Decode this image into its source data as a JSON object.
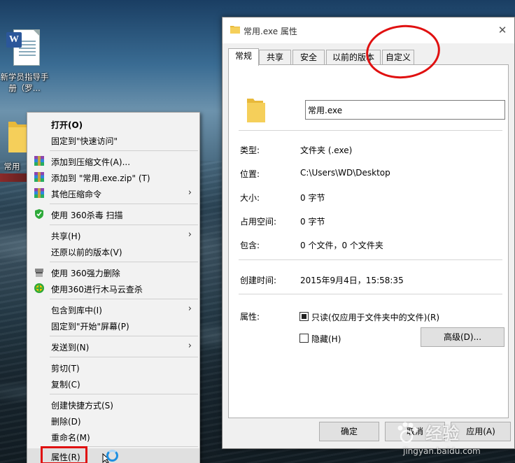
{
  "desktop": {
    "doc_icon_label": "新学员指导手册（罗...",
    "folder_icon_label": "常用"
  },
  "context_menu": {
    "items": [
      {
        "label": "打开(O)"
      },
      {
        "label": "固定到\"快速访问\""
      },
      {
        "label": "添加到压缩文件(A)..."
      },
      {
        "label": "添加到 \"常用.exe.zip\" (T)"
      },
      {
        "label": "其他压缩命令"
      },
      {
        "label": "使用 360杀毒 扫描"
      },
      {
        "label": "共享(H)"
      },
      {
        "label": "还原以前的版本(V)"
      },
      {
        "label": "使用 360强力删除"
      },
      {
        "label": "使用360进行木马云查杀"
      },
      {
        "label": "包含到库中(I)"
      },
      {
        "label": "固定到\"开始\"屏幕(P)"
      },
      {
        "label": "发送到(N)"
      },
      {
        "label": "剪切(T)"
      },
      {
        "label": "复制(C)"
      },
      {
        "label": "创建快捷方式(S)"
      },
      {
        "label": "删除(D)"
      },
      {
        "label": "重命名(M)"
      },
      {
        "label": "属性(R)"
      }
    ]
  },
  "dialog": {
    "title": "常用.exe 属性",
    "close_glyph": "✕",
    "tabs": [
      "常规",
      "共享",
      "安全",
      "以前的版本",
      "自定义"
    ],
    "active_tab": "常规",
    "name_value": "常用.exe",
    "props": {
      "type_label": "类型:",
      "type_value": "文件夹 (.exe)",
      "location_label": "位置:",
      "location_value": "C:\\Users\\WD\\Desktop",
      "size_label": "大小:",
      "size_value": "0 字节",
      "disk_label": "占用空间:",
      "disk_value": "0 字节",
      "contains_label": "包含:",
      "contains_value": "0 个文件，0 个文件夹",
      "created_label": "创建时间:",
      "created_value": "2015年9月4日，15:58:35",
      "attr_label": "属性:",
      "readonly_label": "只读(仅应用于文件夹中的文件)(R)",
      "readonly_checked": true,
      "hidden_label": "隐藏(H)",
      "hidden_checked": false,
      "advanced_button": "高级(D)..."
    },
    "buttons": {
      "ok": "确定",
      "cancel": "取消",
      "apply": "应用(A)"
    }
  },
  "watermark": {
    "logo_text": "Bai",
    "text": "经验",
    "url": "jingyan.baidu.com"
  },
  "colors": {
    "annotation_red": "#e01010",
    "folder_yellow": "#f5c842",
    "selection_gray": "#e0e0e0"
  }
}
